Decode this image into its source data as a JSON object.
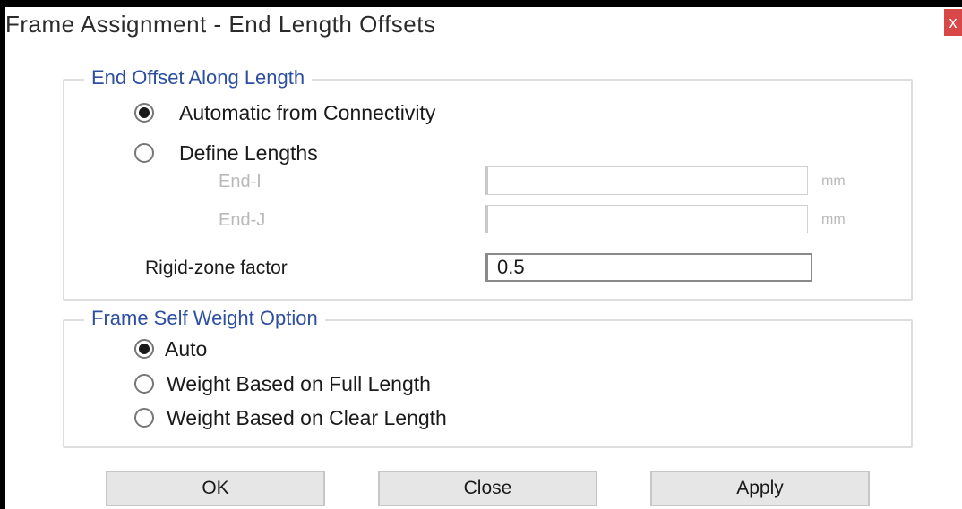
{
  "window": {
    "title": "Frame Assignment - End Length Offsets",
    "close_glyph": "x"
  },
  "end_offset_group": {
    "legend": "End Offset Along Length",
    "options": [
      {
        "label": "Automatic from Connectivity",
        "selected": true
      },
      {
        "label": "Define Lengths",
        "selected": false
      }
    ],
    "end_i": {
      "label": "End-I",
      "value": "",
      "unit": "mm",
      "enabled": false
    },
    "end_j": {
      "label": "End-J",
      "value": "",
      "unit": "mm",
      "enabled": false
    },
    "rigid_zone": {
      "label": "Rigid-zone factor",
      "value": "0.5"
    }
  },
  "self_weight_group": {
    "legend": "Frame Self Weight Option",
    "options": [
      {
        "label": "Auto",
        "selected": true
      },
      {
        "label": "Weight Based on Full Length",
        "selected": false
      },
      {
        "label": "Weight Based on Clear Length",
        "selected": false
      }
    ]
  },
  "buttons": {
    "ok": "OK",
    "close": "Close",
    "apply": "Apply"
  },
  "colors": {
    "legend_text": "#2d4fa0",
    "close_button": "#d94848",
    "disabled_text": "#b9b9b9"
  }
}
